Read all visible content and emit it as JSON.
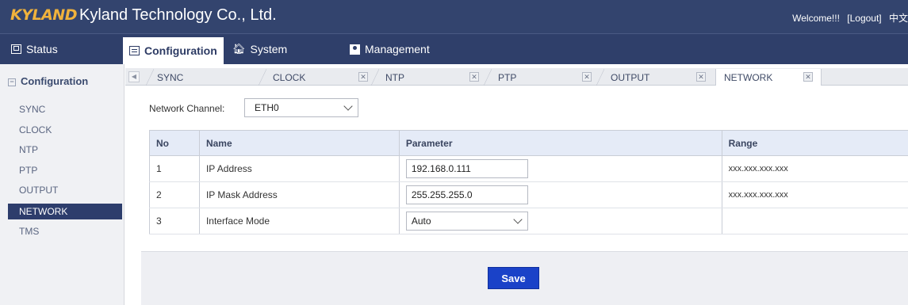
{
  "header": {
    "logo_text": "KYLAND",
    "company": "Kyland Technology Co., Ltd.",
    "welcome": "Welcome!!!",
    "logout": "[Logout]",
    "language": "中文",
    "colors": {
      "header_bg": "#33446e",
      "logo": "#f0b23c",
      "accent": "#2d3d6c",
      "save_button": "#1a42c8"
    }
  },
  "nav": {
    "status": "Status",
    "configuration": "Configuration",
    "system": "System",
    "management": "Management"
  },
  "sidebar": {
    "title": "Configuration",
    "items": [
      {
        "label": "SYNC"
      },
      {
        "label": "CLOCK"
      },
      {
        "label": "NTP"
      },
      {
        "label": "PTP"
      },
      {
        "label": "OUTPUT"
      },
      {
        "label": "NETWORK"
      },
      {
        "label": "TMS"
      }
    ]
  },
  "tabs": [
    {
      "label": "SYNC"
    },
    {
      "label": "CLOCK"
    },
    {
      "label": "NTP"
    },
    {
      "label": "PTP"
    },
    {
      "label": "OUTPUT"
    },
    {
      "label": "NETWORK"
    }
  ],
  "form": {
    "channel_label": "Network Channel:",
    "channel_value": "ETH0"
  },
  "table": {
    "headers": [
      "No",
      "Name",
      "Parameter",
      "Range"
    ],
    "rows": [
      {
        "no": "1",
        "name": "IP Address",
        "param": "192.168.0.111",
        "range": "xxx.xxx.xxx.xxx"
      },
      {
        "no": "2",
        "name": "IP Mask Address",
        "param": "255.255.255.0",
        "range": "xxx.xxx.xxx.xxx"
      },
      {
        "no": "3",
        "name": "Interface Mode",
        "param": "Auto",
        "range": ""
      }
    ]
  },
  "actions": {
    "save": "Save"
  }
}
